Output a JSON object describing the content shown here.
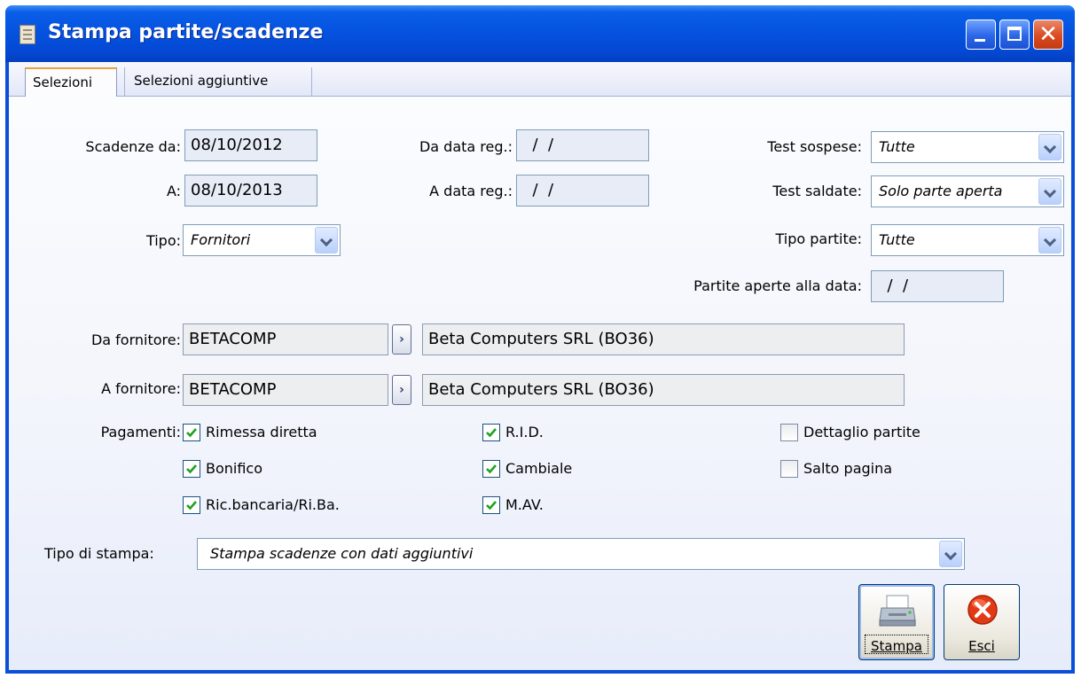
{
  "window": {
    "title": "Stampa partite/scadenze"
  },
  "tabs": [
    {
      "label": "Selezioni",
      "active": true
    },
    {
      "label": "Selezioni aggiuntive",
      "active": false
    }
  ],
  "form": {
    "scadenze_da": {
      "label": "Scadenze da:",
      "value": "08/10/2012"
    },
    "scadenze_a": {
      "label": "A:",
      "value": "08/10/2013"
    },
    "tipo": {
      "label": "Tipo:",
      "value": "Fornitori"
    },
    "da_data_reg": {
      "label": "Da data reg.:",
      "value": "  /  /"
    },
    "a_data_reg": {
      "label": "A data reg.:",
      "value": "  /  /"
    },
    "test_sospese": {
      "label": "Test sospese:",
      "value": "Tutte"
    },
    "test_saldate": {
      "label": "Test saldate:",
      "value": "Solo parte aperta"
    },
    "tipo_partite": {
      "label": "Tipo partite:",
      "value": "Tutte"
    },
    "partite_aperte": {
      "label": "Partite aperte alla data:",
      "value": "  /  /"
    },
    "da_fornitore": {
      "label": "Da fornitore:",
      "code": "BETACOMP",
      "description": "Beta Computers SRL (BO36)"
    },
    "a_fornitore": {
      "label": "A fornitore:",
      "code": "BETACOMP",
      "description": "Beta Computers SRL (BO36)"
    },
    "pagamenti_label": "Pagamenti:",
    "pagamenti": [
      {
        "label": "Rimessa diretta",
        "checked": true
      },
      {
        "label": "Bonifico",
        "checked": true
      },
      {
        "label": "Ric.bancaria/Ri.Ba.",
        "checked": true
      },
      {
        "label": "R.I.D.",
        "checked": true
      },
      {
        "label": "Cambiale",
        "checked": true
      },
      {
        "label": "M.AV.",
        "checked": true
      }
    ],
    "opzioni": [
      {
        "label": "Dettaglio partite",
        "checked": false
      },
      {
        "label": "Salto pagina",
        "checked": false
      }
    ],
    "tipo_stampa": {
      "label": "Tipo di stampa:",
      "value": "Stampa scadenze con dati aggiuntivi"
    }
  },
  "buttons": {
    "stampa": "Stampa",
    "esci": "Esci"
  },
  "colors": {
    "titlebar": "#0553e0",
    "check": "#21a121",
    "close": "#d94a22",
    "esci_icon": "#e23a14"
  }
}
